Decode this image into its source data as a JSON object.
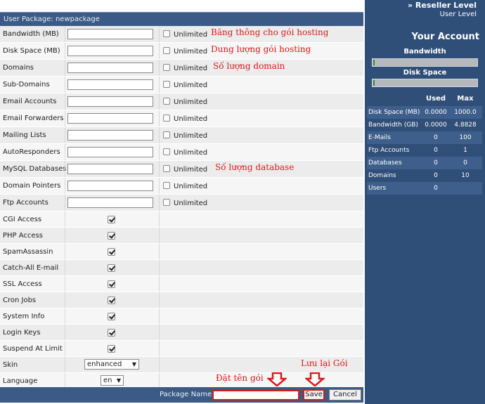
{
  "header": {
    "title": "User Package: newpackage"
  },
  "limits": [
    {
      "label": "Bandwidth (MB)",
      "unlimited_label": "Unlimited",
      "note": "Băng thông cho gói hosting"
    },
    {
      "label": "Disk Space (MB)",
      "unlimited_label": "Unlimited",
      "note": "Dung lượng gói hosting"
    },
    {
      "label": "Domains",
      "unlimited_label": "Unlimited",
      "note": "Số lượng domain"
    },
    {
      "label": "Sub-Domains",
      "unlimited_label": "Unlimited",
      "note": ""
    },
    {
      "label": "Email Accounts",
      "unlimited_label": "Unlimited",
      "note": ""
    },
    {
      "label": "Email Forwarders",
      "unlimited_label": "Unlimited",
      "note": ""
    },
    {
      "label": "Mailing Lists",
      "unlimited_label": "Unlimited",
      "note": ""
    },
    {
      "label": "AutoResponders",
      "unlimited_label": "Unlimited",
      "note": ""
    },
    {
      "label": "MySQL Databases",
      "unlimited_label": "Unlimited",
      "note": "Số lượng database"
    },
    {
      "label": "Domain Pointers",
      "unlimited_label": "Unlimited",
      "note": ""
    },
    {
      "label": "Ftp Accounts",
      "unlimited_label": "Unlimited",
      "note": ""
    }
  ],
  "features": [
    {
      "label": "CGI Access",
      "checked": true
    },
    {
      "label": "PHP Access",
      "checked": true
    },
    {
      "label": "SpamAssassin",
      "checked": true
    },
    {
      "label": "Catch-All E-mail",
      "checked": true
    },
    {
      "label": "SSL Access",
      "checked": true
    },
    {
      "label": "Cron Jobs",
      "checked": true
    },
    {
      "label": "System Info",
      "checked": true
    },
    {
      "label": "Login Keys",
      "checked": true
    },
    {
      "label": "Suspend At Limit",
      "checked": true
    }
  ],
  "skin": {
    "label": "Skin",
    "value": "enhanced"
  },
  "language": {
    "label": "Language",
    "value": "en"
  },
  "footer": {
    "package_name_label": "Package Name:",
    "package_name_value": "",
    "save_label": "Save",
    "cancel_label": "Cancel",
    "name_annotation": "Đặt tên gói",
    "save_annotation": "Lưu lại Gói"
  },
  "sidebar": {
    "reseller_link": "» Reseller Level",
    "user_level": "User Level",
    "your_account": "Your Account",
    "bandwidth_label": "Bandwidth",
    "disk_space_label": "Disk Space",
    "bandwidth_usage": 0.0,
    "disk_usage": 0.0,
    "columns": [
      "Used",
      "Max"
    ],
    "stats": [
      {
        "name": "Disk Space (MB)",
        "used": "0.0000",
        "max": "1000.0"
      },
      {
        "name": "Bandwidth (GB)",
        "used": "0.0000",
        "max": "4.8828"
      },
      {
        "name": "E-Mails",
        "used": "0",
        "max": "100"
      },
      {
        "name": "Ftp Accounts",
        "used": "0",
        "max": "1"
      },
      {
        "name": "Databases",
        "used": "0",
        "max": "0"
      },
      {
        "name": "Domains",
        "used": "0",
        "max": "10"
      },
      {
        "name": "Users",
        "used": "0",
        "max": ""
      }
    ]
  },
  "colors": {
    "header_blue": "#3b5a85",
    "sidebar_blue": "#2f4e78",
    "annotation_red": "#e0181b"
  }
}
